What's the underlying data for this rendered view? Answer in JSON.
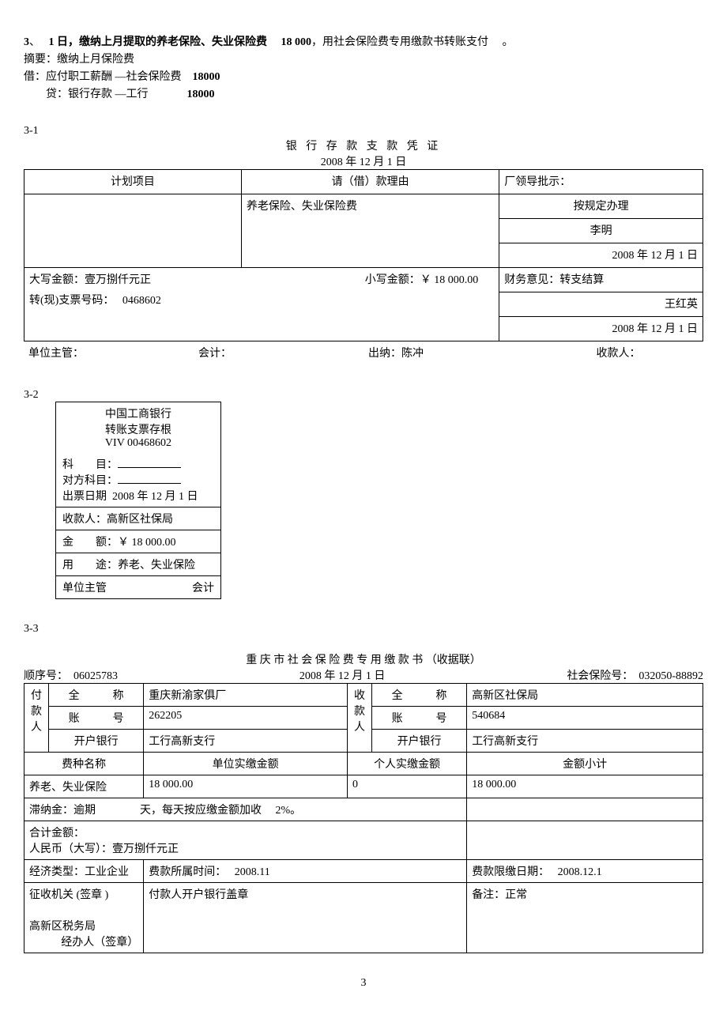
{
  "header": {
    "item_no": "3",
    "sep": "、",
    "day_label": "1 日，缴纳上月提取的养老保险、失业保险费",
    "amount": "18 000",
    "tail": "，用社会保险费专用缴款书转账支付",
    "period": "。",
    "summary_label": "摘要：缴纳上月保险费",
    "debit": "借：应付职工薪酬  —社会保险费",
    "debit_amt": "18000",
    "credit": "贷：银行存款  —工行",
    "credit_amt": "18000"
  },
  "sec1": {
    "tag": "3-1",
    "title": "银 行 存 款 支 款 凭 证",
    "date": "2008 年  12 月  1 日",
    "col1": "计划项目",
    "col2": "请（借）款理由",
    "col3": "厂领导批示：",
    "reason": "养老保险、失业保险费",
    "approve_line1": "按规定办理",
    "approve_line2": "李明",
    "approve_line3": "2008 年 12 月 1 日",
    "big_amt_label": "大写金额：壹万捌仟元正",
    "small_amt_label": "小写金额：￥  18 000.00",
    "fin_opinion": "财务意见：转支结算",
    "fin_name": "王红英",
    "fin_date": "2008 年 12 月 1 日",
    "cheque_label": "转(现)支票号码：",
    "cheque_no": "0468602",
    "footer_unit": "单位主管：",
    "footer_acct": "会计：",
    "footer_cashier": "出纳：陈冲",
    "footer_payee": "收款人："
  },
  "sec2": {
    "tag": "3-2",
    "bank": "中国工商银行",
    "stub": "转账支票存根",
    "num": "VIV 00468602",
    "subject_lbl": "科　　目：",
    "opp_subject_lbl": "对方科目：",
    "issue_date_lbl": "出票日期",
    "issue_date": "2008 年  12 月 1 日",
    "payee_lbl": "收款人：高新区社保局",
    "amount_lbl": "金　　额：￥ 18 000.00",
    "use_lbl": "用　　途：养老、失业保险",
    "footer_unit": "单位主管",
    "footer_acct": "会计"
  },
  "sec3": {
    "tag": "3-3",
    "title": "重 庆 市 社 会 保 险 费 专 用 缴 款 书 （收据联）",
    "seq_lbl": "顺序号：",
    "seq": "06025783",
    "date": "2008 年 12 月 1 日",
    "ins_no_lbl": "社会保险号：",
    "ins_no": "032050-88892",
    "payer_v": "付款人",
    "payee_v": "收款人",
    "name_lbl": "全　　　称",
    "acct_lbl": "账　　　号",
    "bank_lbl": "开户银行",
    "payer_name": "重庆新渝家俱厂",
    "payer_acct": "262205",
    "payer_bank": "工行高新支行",
    "payee_name": "高新区社保局",
    "payee_acct": "540684",
    "payee_bank": "工行高新支行",
    "fee_name_hdr": "费种名称",
    "unit_paid_hdr": "单位实缴金额",
    "pers_paid_hdr": "个人实缴金额",
    "subtotal_hdr": "金额小计",
    "fee_name": "养老、失业保险",
    "unit_paid": "18 000.00",
    "pers_paid": "0",
    "subtotal": "18 000.00",
    "late_fee": "滞纳金：逾期　　　　天，每天按应缴金额加收　 2%。",
    "total_lbl": "合计金额：",
    "rmb_words": "人民币（大写）：壹万捌仟元正",
    "econ_type": "经济类型：工业企业",
    "fee_period": "费款所属时间：　 2008.11",
    "fee_deadline": "费款限缴日期：　 2008.12.1",
    "levy_org": "征收机关 (签章 )",
    "payer_bank_seal": "付款人开户银行盖章",
    "remark": "备注：正常",
    "tax_bureau": "高新区税务局",
    "handler": "经办人（签章）"
  },
  "page_num": "3"
}
